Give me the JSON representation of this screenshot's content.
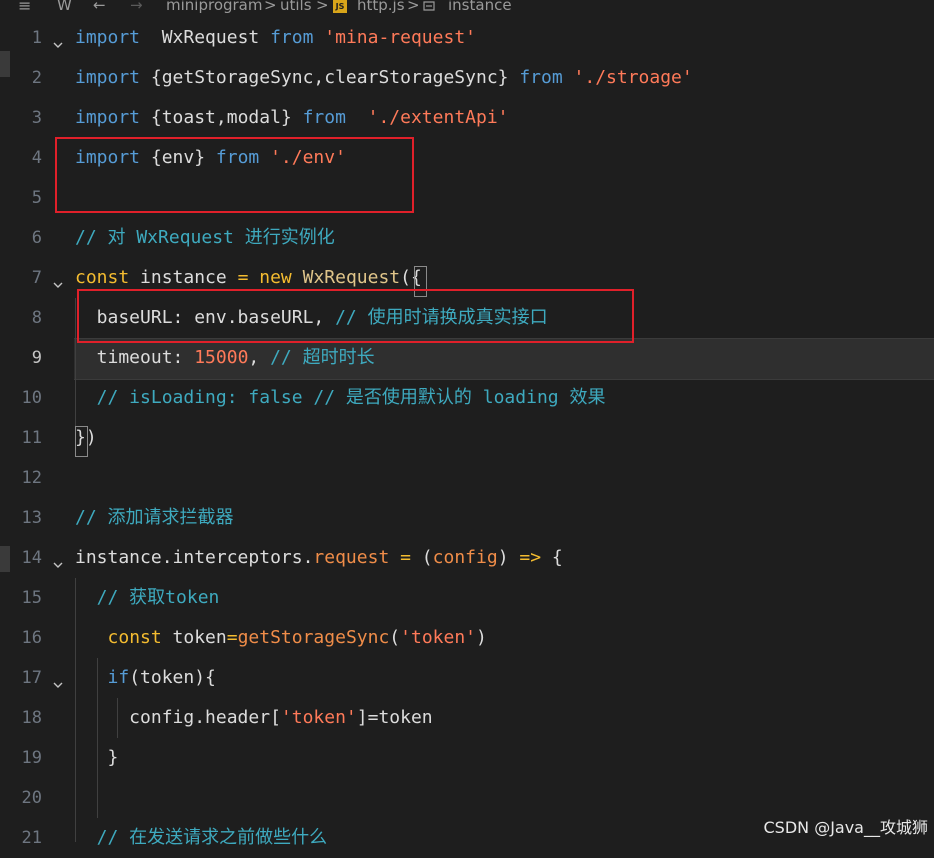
{
  "breadcrumb": {
    "menu_glyph": "≡",
    "bookmark_glyph": "W",
    "back_glyph": "←",
    "forward_glyph": "→",
    "segments": [
      "miniprogram",
      "utils",
      "http.js",
      "instance"
    ],
    "separator": ">",
    "js_badge": "JS"
  },
  "editor": {
    "active_line": "9",
    "lines": [
      {
        "n": "1",
        "t": [
          [
            "kw",
            "import"
          ],
          [
            "",
            "  WxRequest "
          ],
          [
            "kw",
            "from"
          ],
          [
            "str",
            " 'mina-request'"
          ]
        ]
      },
      {
        "n": "2",
        "t": [
          [
            "kw",
            "import"
          ],
          [
            "",
            " {getStorageSync,clearStorageSync} "
          ],
          [
            "kw",
            "from"
          ],
          [
            "str",
            " './stroage'"
          ]
        ]
      },
      {
        "n": "3",
        "t": [
          [
            "kw",
            "import"
          ],
          [
            "",
            " {toast,modal} "
          ],
          [
            "kw",
            "from"
          ],
          [
            "str",
            "  './extentApi'"
          ]
        ]
      },
      {
        "n": "4",
        "t": [
          [
            "kw",
            "import"
          ],
          [
            "",
            " {env} "
          ],
          [
            "kw",
            "from"
          ],
          [
            "str",
            " './env'"
          ]
        ]
      },
      {
        "n": "5",
        "t": []
      },
      {
        "n": "6",
        "t": [
          [
            "cmt",
            "// 对 WxRequest 进行实例化"
          ]
        ]
      },
      {
        "n": "7",
        "t": [
          [
            "kw2",
            "const"
          ],
          [
            "",
            " instance "
          ],
          [
            "kw2",
            "="
          ],
          [
            "",
            " "
          ],
          [
            "kw2",
            "new"
          ],
          [
            "",
            " "
          ],
          [
            "cls",
            "WxRequest"
          ],
          [
            "",
            "({"
          ]
        ]
      },
      {
        "n": "8",
        "t": [
          [
            "",
            "  baseURL: env.baseURL, "
          ],
          [
            "cmt",
            "// 使用时请换成真实接口"
          ]
        ]
      },
      {
        "n": "9",
        "t": [
          [
            "",
            "  timeout: "
          ],
          [
            "num",
            "15000"
          ],
          [
            "",
            ", "
          ],
          [
            "cmt",
            "// 超时时长"
          ]
        ]
      },
      {
        "n": "10",
        "t": [
          [
            "cmt",
            "  // isLoading: false // 是否使用默认的 loading 效果"
          ]
        ]
      },
      {
        "n": "11",
        "t": [
          [
            "",
            "})"
          ]
        ]
      },
      {
        "n": "12",
        "t": []
      },
      {
        "n": "13",
        "t": [
          [
            "cmt",
            "// 添加请求拦截器"
          ]
        ]
      },
      {
        "n": "14",
        "t": [
          [
            "",
            "instance.interceptors."
          ],
          [
            "fn",
            "request"
          ],
          [
            "",
            " "
          ],
          [
            "kw2",
            "="
          ],
          [
            "",
            " ("
          ],
          [
            "fn",
            "config"
          ],
          [
            "",
            ") "
          ],
          [
            "kw2",
            "=>"
          ],
          [
            "",
            " {"
          ]
        ]
      },
      {
        "n": "15",
        "t": [
          [
            "cmt",
            "  // 获取token"
          ]
        ]
      },
      {
        "n": "16",
        "t": [
          [
            "",
            "   "
          ],
          [
            "kw2",
            "const"
          ],
          [
            "",
            " token"
          ],
          [
            "kw2",
            "="
          ],
          [
            "fn",
            "getStorageSync"
          ],
          [
            "",
            "("
          ],
          [
            "str",
            "'token'"
          ],
          [
            "",
            ")"
          ]
        ]
      },
      {
        "n": "17",
        "t": [
          [
            "",
            "   "
          ],
          [
            "kw",
            "if"
          ],
          [
            "",
            "(token){"
          ]
        ]
      },
      {
        "n": "18",
        "t": [
          [
            "",
            "     config.header["
          ],
          [
            "str",
            "'token'"
          ],
          [
            "",
            "]=token"
          ]
        ]
      },
      {
        "n": "19",
        "t": [
          [
            "",
            "   }"
          ]
        ]
      },
      {
        "n": "20",
        "t": []
      },
      {
        "n": "21",
        "t": [
          [
            "cmt",
            "  // 在发送请求之前做些什么"
          ]
        ]
      }
    ]
  },
  "watermark": "CSDN @Java__攻城狮",
  "colors": {
    "background": "#1e1e1e",
    "keyword_blue": "#569cd6",
    "keyword_gold": "#f4bc30",
    "string": "#ff7a59",
    "comment": "#3eaabf",
    "annotation_red": "#e0202a"
  }
}
